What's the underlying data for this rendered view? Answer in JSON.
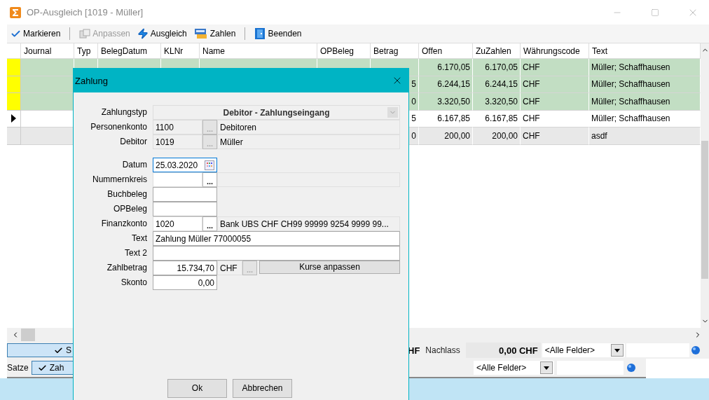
{
  "window": {
    "title": "OP-Ausgleich [1019 - Müller]",
    "active": false
  },
  "toolbar": [
    {
      "kind": "button",
      "label": "Markieren",
      "disabled": false
    },
    {
      "kind": "separator"
    },
    {
      "kind": "button",
      "label": "Anpassen",
      "disabled": true
    },
    {
      "kind": "button",
      "label": "Ausgleich",
      "disabled": false
    },
    {
      "kind": "button",
      "label": "Zahlen",
      "disabled": false
    },
    {
      "kind": "separator"
    },
    {
      "kind": "button",
      "label": "Beenden",
      "disabled": false
    }
  ],
  "table": {
    "columns": [
      "Journal",
      "Typ",
      "BelegDatum",
      "KLNr",
      "Name",
      "OPBeleg",
      "Betrag",
      "Offen",
      "ZuZahlen",
      "Währungscode",
      "Text"
    ],
    "rows": [
      {
        "kind": "entry",
        "selected": true,
        "current": false,
        "cells": [
          null,
          null,
          null,
          null,
          null,
          null,
          null,
          "6.170,05",
          "6.170,05",
          "CHF",
          "Müller; Schaffhausen"
        ]
      },
      {
        "kind": "entry",
        "selected": true,
        "current": false,
        "cells": [
          null,
          null,
          null,
          null,
          null,
          null,
          "5",
          "6.244,15",
          "6.244,15",
          "CHF",
          "Müller; Schaffhausen"
        ]
      },
      {
        "kind": "entry",
        "selected": true,
        "current": false,
        "cells": [
          null,
          null,
          null,
          null,
          null,
          null,
          "0",
          "3.320,50",
          "3.320,50",
          "CHF",
          "Müller; Schaffhausen"
        ]
      },
      {
        "kind": "entry",
        "selected": false,
        "current": true,
        "cells": [
          null,
          null,
          null,
          null,
          null,
          null,
          "5",
          "6.167,85",
          "6.167,85",
          "CHF",
          "Müller; Schaffhausen"
        ]
      },
      {
        "kind": "total",
        "selected": false,
        "current": false,
        "cells": [
          null,
          null,
          null,
          null,
          null,
          null,
          "0",
          "200,00",
          "200,00",
          "CHF",
          "asdf"
        ]
      }
    ]
  },
  "status_bar": {
    "toggle": {
      "label": "S",
      "checked": true
    },
    "fragment": "HF",
    "discount_label": "Nachlass",
    "discount_value": "0,00 CHF",
    "filter": "<Alle Felder>"
  },
  "back_window": {
    "count_label": "Satze",
    "toggle": {
      "label": "Zah",
      "checked": true
    },
    "filter": "<Alle Felder>"
  },
  "dialog": {
    "title": "Zahlung",
    "sections": [
      {
        "fields": [
          {
            "kind": "combo",
            "label": "Zahlungstyp",
            "value": "Debitor - Zahlungseingang",
            "disabled": true
          },
          {
            "kind": "lookup",
            "label": "Personenkonto",
            "value": "1100",
            "button": "...",
            "description": "Debitoren",
            "disabled": true
          },
          {
            "kind": "lookup",
            "label": "Debitor",
            "value": "1019",
            "button": "...",
            "description": "Müller",
            "disabled": true
          }
        ]
      },
      {
        "fields": [
          {
            "kind": "date",
            "label": "Datum",
            "value": "25.03.2020",
            "focused": true
          },
          {
            "kind": "lookup",
            "label": "Nummernkreis",
            "button": "...",
            "disabled": false
          },
          {
            "kind": "text",
            "label": "Buchbeleg",
            "wide": false
          },
          {
            "kind": "text",
            "label": "OPBeleg",
            "wide": false
          },
          {
            "kind": "lookup",
            "label": "Finanzkonto",
            "value": "1020",
            "button": "...",
            "description": "Bank UBS CHF CH99 99999 9254 9999 99...",
            "disabled": false
          },
          {
            "kind": "text",
            "label": "Text",
            "value": "Zahlung Müller 77000055",
            "wide": true
          },
          {
            "kind": "text",
            "label": "Text 2",
            "wide": true
          },
          {
            "kind": "amount",
            "label": "Zahlbetrag",
            "value": "15.734,70",
            "currency": "CHF",
            "button": "...",
            "action": "Kurse anpassen"
          },
          {
            "kind": "amount",
            "label": "Skonto",
            "value": "0,00"
          }
        ]
      }
    ],
    "buttons": [
      "Ok",
      "Abbrechen"
    ]
  }
}
